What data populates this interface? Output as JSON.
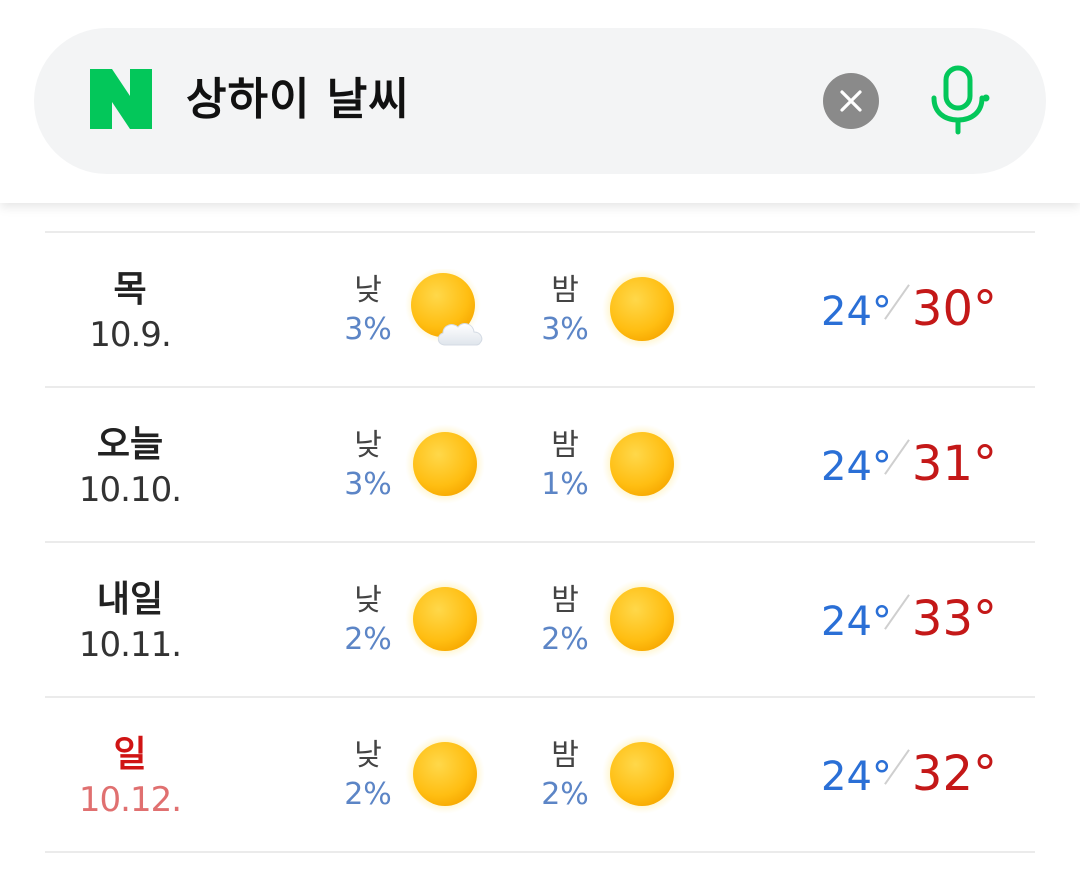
{
  "search": {
    "logo": "N",
    "query": "상하이 날씨"
  },
  "icons": {
    "logo": "naver-n-logo",
    "clear": "close-icon",
    "mic": "microphone-icon",
    "sun": "sun-icon",
    "partly_cloudy": "sun-cloud-icon"
  },
  "colors": {
    "brand_green": "#03c75a",
    "min_temp": "#2a6fd6",
    "max_temp": "#c41818",
    "precip": "#5c85c6",
    "holiday": "#d01414"
  },
  "forecast": [
    {
      "day": "목",
      "date": "10.9.",
      "holiday": false,
      "am_label": "낮",
      "am_precip": "3%",
      "am_icon": "sun-cloud-icon",
      "pm_label": "밤",
      "pm_precip": "3%",
      "pm_icon": "sun-icon",
      "min": "24°",
      "max": "30°"
    },
    {
      "day": "오늘",
      "date": "10.10.",
      "holiday": false,
      "am_label": "낮",
      "am_precip": "3%",
      "am_icon": "sun-icon",
      "pm_label": "밤",
      "pm_precip": "1%",
      "pm_icon": "sun-icon",
      "min": "24°",
      "max": "31°"
    },
    {
      "day": "내일",
      "date": "10.11.",
      "holiday": false,
      "am_label": "낮",
      "am_precip": "2%",
      "am_icon": "sun-icon",
      "pm_label": "밤",
      "pm_precip": "2%",
      "pm_icon": "sun-icon",
      "min": "24°",
      "max": "33°"
    },
    {
      "day": "일",
      "date": "10.12.",
      "holiday": true,
      "am_label": "낮",
      "am_precip": "2%",
      "am_icon": "sun-icon",
      "pm_label": "밤",
      "pm_precip": "2%",
      "pm_icon": "sun-icon",
      "min": "24°",
      "max": "32°"
    }
  ]
}
